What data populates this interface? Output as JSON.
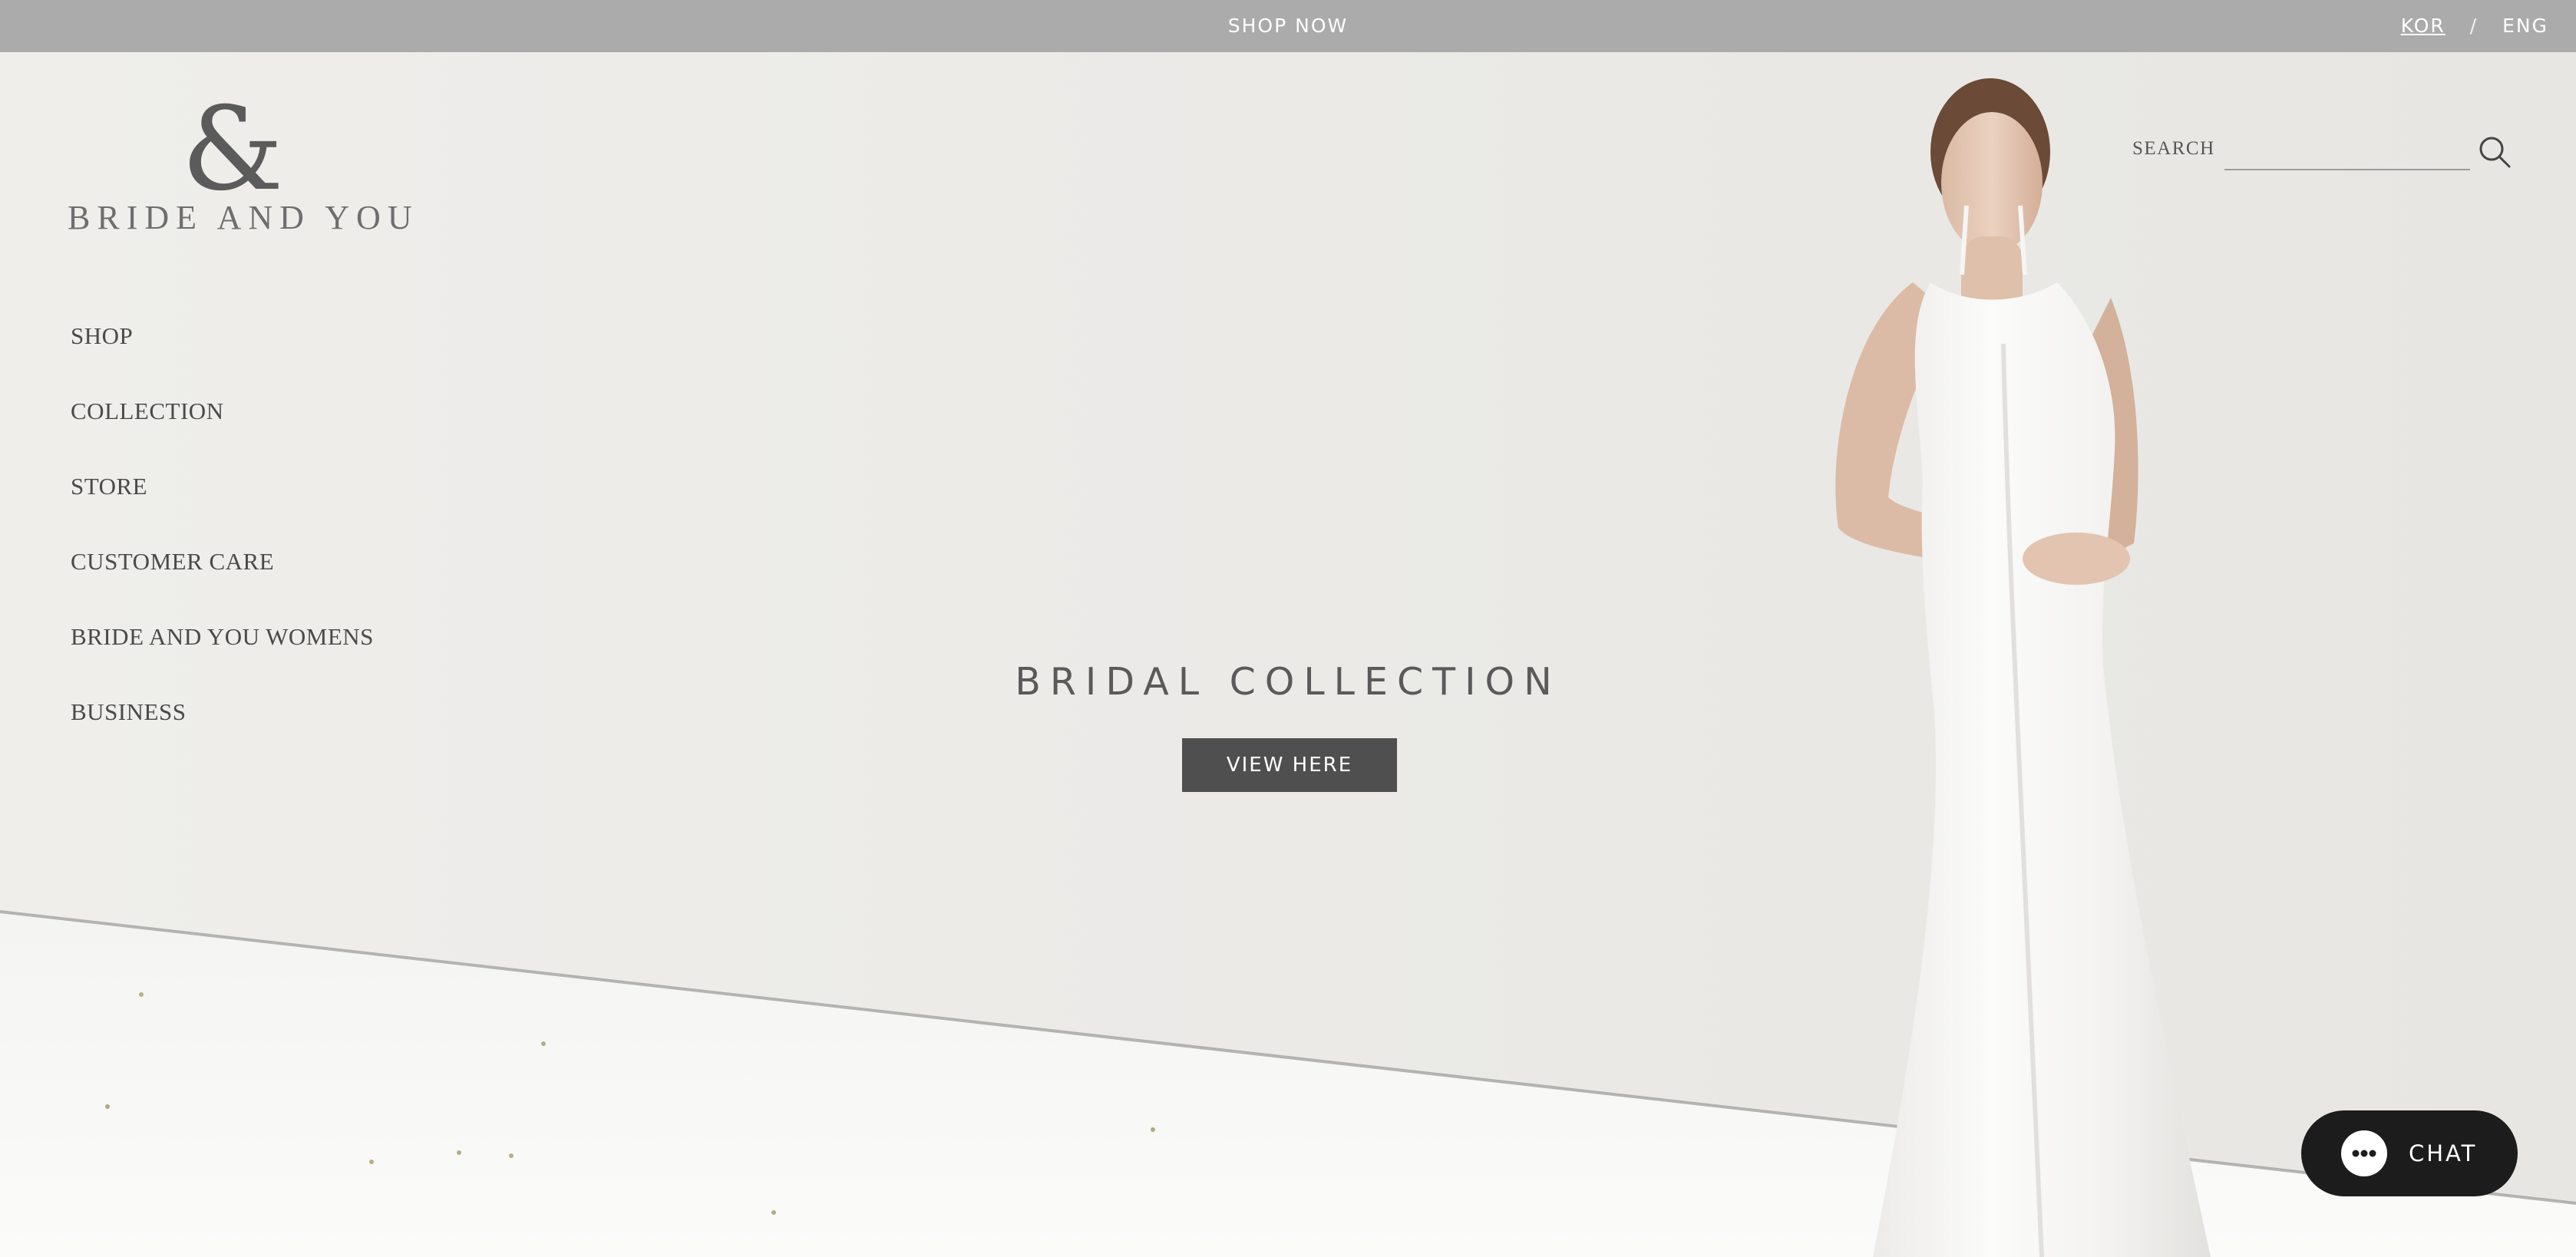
{
  "banner": {
    "shop_now": "SHOP NOW",
    "lang_kor": "KOR",
    "lang_sep": "/",
    "lang_eng": "ENG"
  },
  "logo": {
    "symbol": "&",
    "brand": "BRIDE AND YOU"
  },
  "nav": {
    "items": [
      "SHOP",
      "COLLECTION",
      "STORE",
      "CUSTOMER CARE",
      "BRIDE AND YOU WOMENS",
      "BUSINESS"
    ]
  },
  "search": {
    "label": "SEARCH",
    "value": "",
    "icon": "search-icon"
  },
  "hero": {
    "title": "BRIDAL COLLECTION",
    "button": "VIEW HERE"
  },
  "chat": {
    "label": "CHAT",
    "icon": "chat-bubble-icon"
  },
  "colors": {
    "banner_bg": "#ababab",
    "button_bg": "#4f4f4f",
    "chat_bg": "#1c1c1c",
    "text": "#4a4a4a"
  }
}
